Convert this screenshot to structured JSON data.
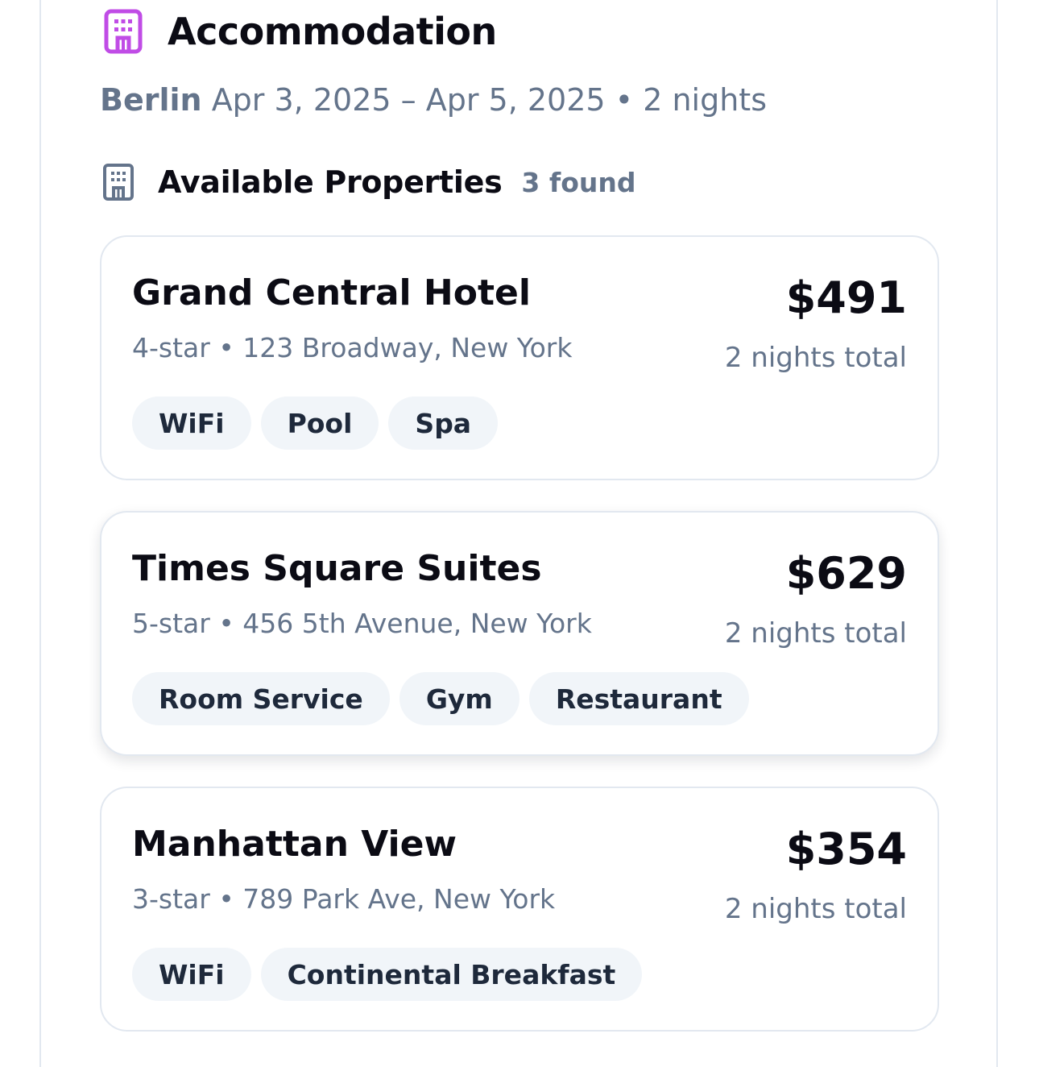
{
  "header": {
    "icon": "hotel-building-icon",
    "title": "Accommodation",
    "accent_color": "#c04ce6"
  },
  "trip": {
    "city": "Berlin",
    "dates": "Apr 3, 2025 – Apr 5, 2025",
    "separator": "•",
    "nights": "2 nights"
  },
  "section": {
    "icon": "building-icon",
    "title": "Available Properties",
    "count": "3 found"
  },
  "properties": [
    {
      "name": "Grand Central Hotel",
      "stars": "4-star",
      "address": "123 Broadway, New York",
      "price": "$491",
      "price_note": "2 nights total",
      "amenities": [
        "WiFi",
        "Pool",
        "Spa"
      ]
    },
    {
      "name": "Times Square Suites",
      "stars": "5-star",
      "address": "456 5th Avenue, New York",
      "price": "$629",
      "price_note": "2 nights total",
      "amenities": [
        "Room Service",
        "Gym",
        "Restaurant"
      ]
    },
    {
      "name": "Manhattan View",
      "stars": "3-star",
      "address": "789 Park Ave, New York",
      "price": "$354",
      "price_note": "2 nights total",
      "amenities": [
        "WiFi",
        "Continental Breakfast"
      ]
    }
  ]
}
